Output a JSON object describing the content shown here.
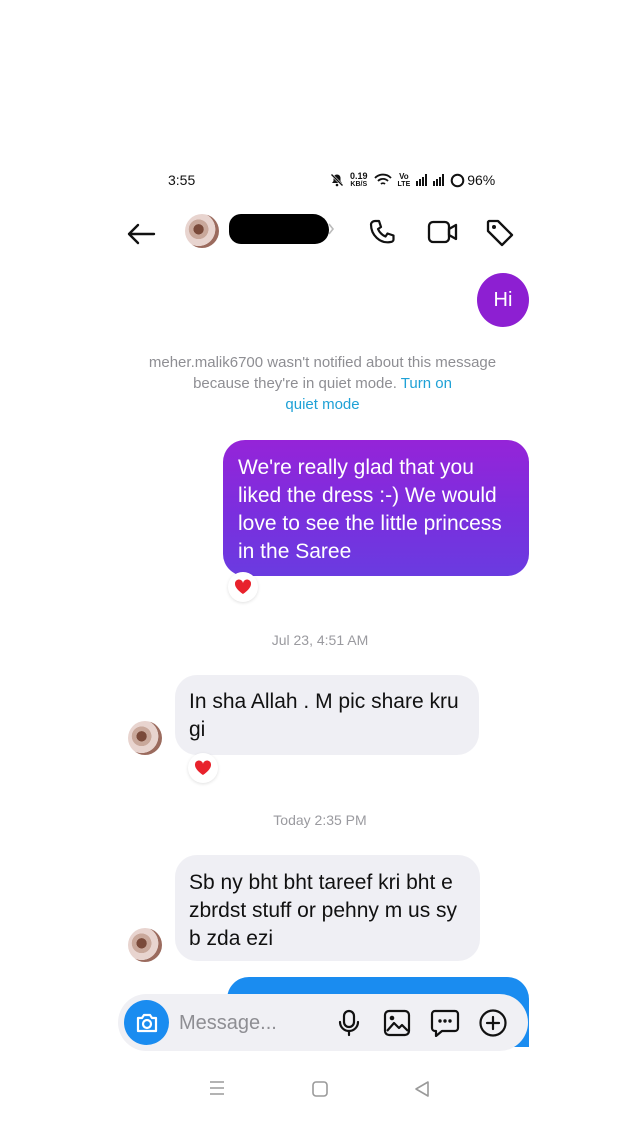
{
  "status_bar": {
    "time": "3:55",
    "net_speed_top": "0.19",
    "net_speed_bottom": "KB/S",
    "volte_top": "Vo",
    "volte_bottom": "LTE",
    "battery": "96%"
  },
  "header": {
    "back_icon": "arrow-left-icon",
    "call_icon": "phone-icon",
    "video_icon": "video-camera-icon",
    "tag_icon": "tag-icon"
  },
  "messages": {
    "hi": "Hi",
    "notice_text": "meher.malik6700 wasn't notified about this message because they're in quiet mode.",
    "notice_link_1": "Turn on",
    "notice_link_2": "quiet mode",
    "out_message": "We're really glad that you liked the dress :-) We would love to see the little princess in the Saree",
    "timestamp_1": "Jul 23, 4:51 AM",
    "in_message_1": "In sha Allah . M pic share kru gi",
    "timestamp_2": "Today 2:35 PM",
    "in_message_2": "Sb ny bht bht tareef kri bht e zbrdst stuff or pehny m us sy b zda ezi"
  },
  "composer": {
    "placeholder": "Message..."
  },
  "colors": {
    "out_bubble_start": "#9524d8",
    "out_bubble_end": "#6a3be0",
    "in_bubble": "#efeff4",
    "link": "#1fa1d6",
    "camera_button": "#1a8cf0"
  }
}
